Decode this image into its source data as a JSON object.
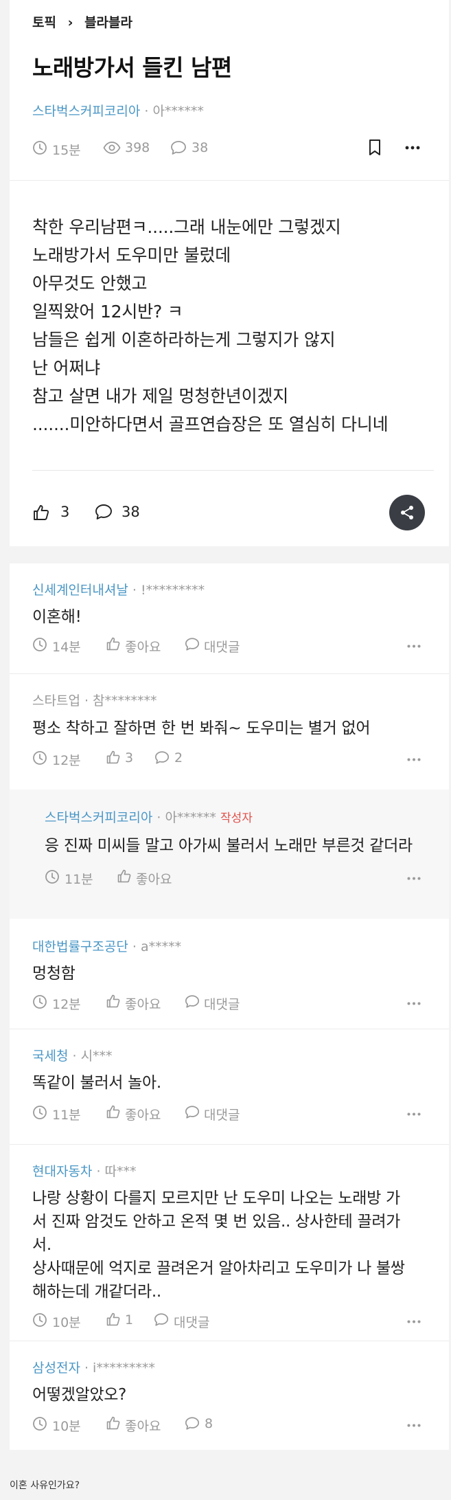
{
  "breadcrumb": {
    "topic": "토픽",
    "sep": "›",
    "board": "블라블라"
  },
  "post": {
    "title": "노래방가서 들킨 남편",
    "company": "스타벅스커피코리아",
    "author": "· 아******",
    "time": "15분",
    "views": "398",
    "comments": "38",
    "body": [
      "착한 우리남편ㅋ.....그래 내눈에만 그렇겠지",
      "노래방가서 도우미만 불렀데",
      "아무것도 안했고",
      "일찍왔어 12시반? ㅋ",
      "남들은 쉽게 이혼하라하는게 그렇지가 않지",
      "난 어쩌냐",
      "참고 살면 내가 제일 멍청한년이겠지",
      ".......미안하다면서 골프연습장은 또 열심히 다니네"
    ],
    "likes": "3",
    "comment_count": "38"
  },
  "comments": [
    {
      "company": "신세계인터내셔날",
      "author": "· !*********",
      "text": [
        "이혼해!"
      ],
      "time": "14분",
      "like": "좋아요",
      "reply": "대댓글"
    },
    {
      "company": "스타트업",
      "author": "· 참********",
      "text": [
        "평소 착하고 잘하면 한 번 봐줘~ 도우미는 별거 없어"
      ],
      "time": "12분",
      "like": "3",
      "reply": "2"
    },
    {
      "company": "스타벅스커피코리아",
      "author": "· 아******",
      "badge": "작성자",
      "text": [
        "응 진짜 미씨들 말고 아가씨 불러서 노래만 부른것 같더라"
      ],
      "time": "11분",
      "like": "좋아요"
    },
    {
      "company": "대한법률구조공단",
      "author": "· a*****",
      "text": [
        "멍청함"
      ],
      "time": "12분",
      "like": "좋아요",
      "reply": "대댓글"
    },
    {
      "company": "국세청",
      "author": "· 시***",
      "text": [
        "똑같이 불러서 놀아."
      ],
      "time": "11분",
      "like": "좋아요",
      "reply": "대댓글"
    },
    {
      "company": "현대자동차",
      "author": "· 따***",
      "text": [
        "나랑 상황이 다를지 모르지만 난 도우미 나오는 노래방 가",
        "서 진짜 암것도 안하고 온적 몇 번 있음.. 상사한테 끌려가",
        "서.",
        "상사때문에 억지로 끌려온거 알아차리고 도우미가 나 불쌍",
        "해하는데 개같더라.."
      ],
      "time": "10분",
      "like": "1",
      "reply": "대댓글"
    },
    {
      "company": "삼성전자",
      "author": "· i*********",
      "text": [
        "어떻겠알았오?"
      ],
      "time": "10분",
      "like": "좋아요",
      "reply": "8"
    }
  ],
  "footer": {
    "caption": "이혼 사유인가요?"
  }
}
